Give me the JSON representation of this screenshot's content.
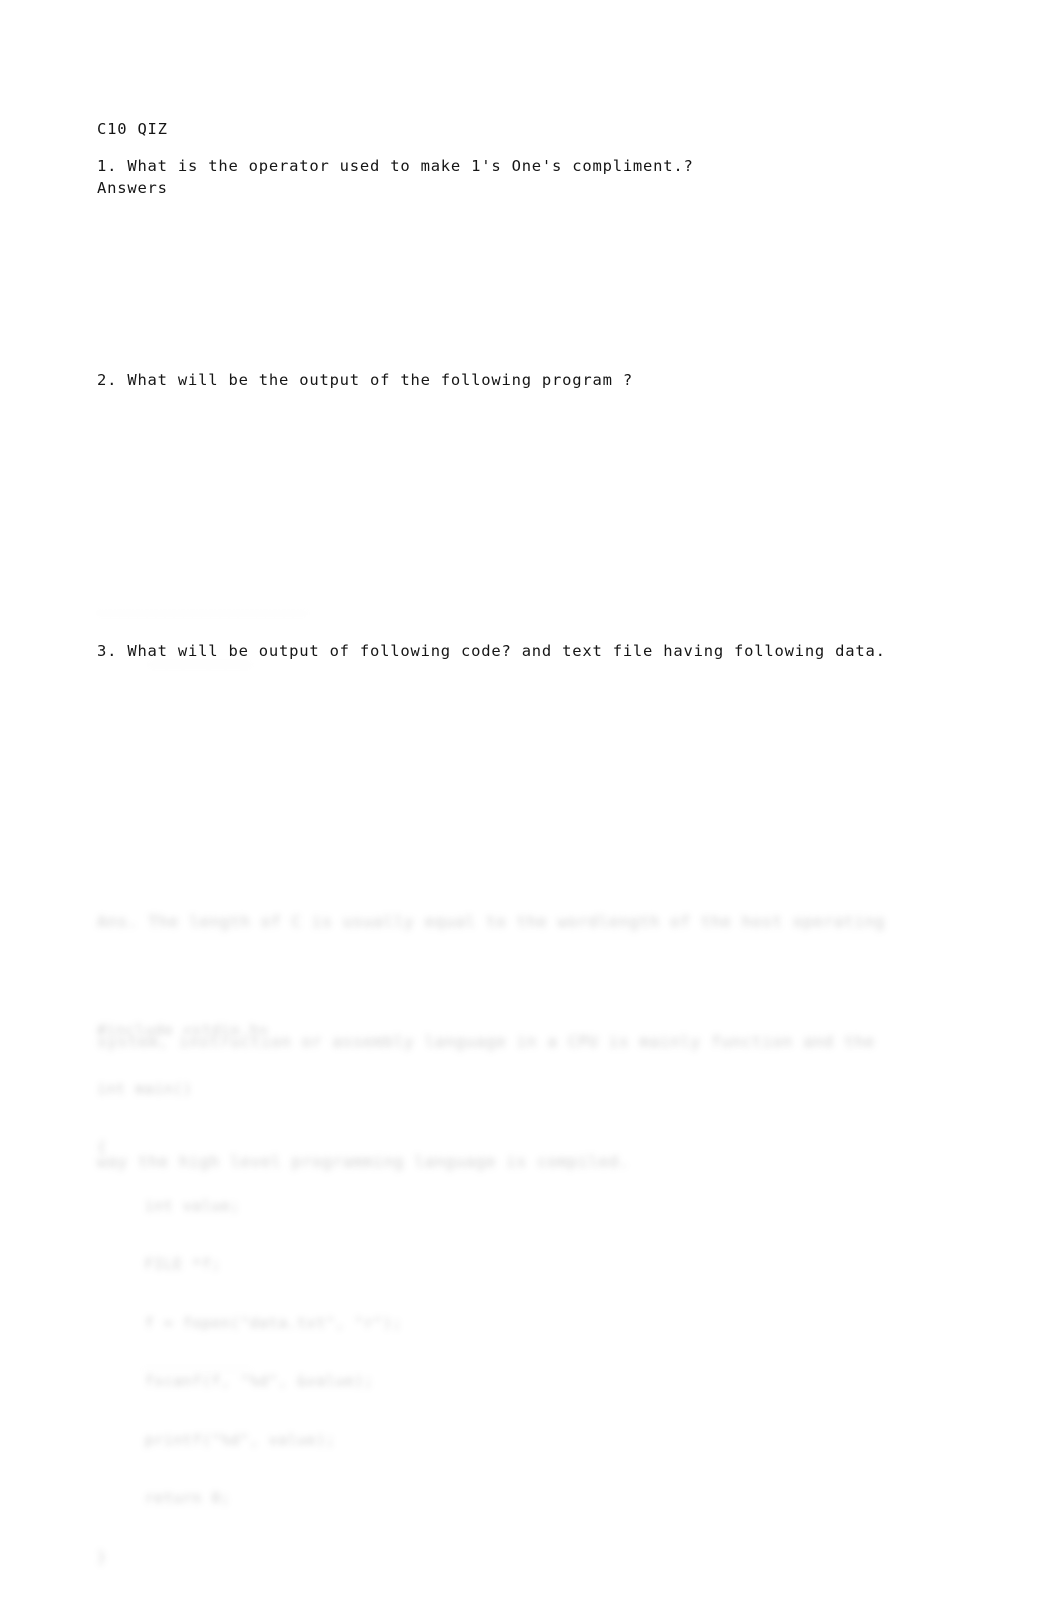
{
  "document": {
    "title": "C10 QIZ",
    "background_color": "#ffffff",
    "text_color": "#161616",
    "questions": [
      {
        "number": "1.",
        "text": "1. What is the operator used to make 1's One's compliment.?",
        "answers_label": "Answers"
      },
      {
        "number": "2.",
        "text": "2. What will be the output of the following program ?"
      },
      {
        "number": "3.",
        "text": "3. What will be output of following code? and text file having following data."
      }
    ],
    "redacted": {
      "note": "blurred-illegible",
      "rule_1": "_______________________",
      "sub_q3": "____________",
      "paragraph_lines": [
        "Ans. The length of C is usually equal to the wordlength of the host operating",
        "system, instruction or assembly language in a CPU is mainly function and the",
        "way the high level programming language is compiled.",
        ""
      ],
      "code_lines": [
        "#include <stdio.h>",
        "int main()",
        "{",
        "     int value;",
        "     FILE *f;",
        "     f = fopen(\"data.txt\", \"r\");",
        "     fscanf(f, \"%d\", &value);",
        "     printf(\"%d\", value);",
        "     return 0;",
        "}"
      ],
      "footer": "_____________"
    }
  }
}
